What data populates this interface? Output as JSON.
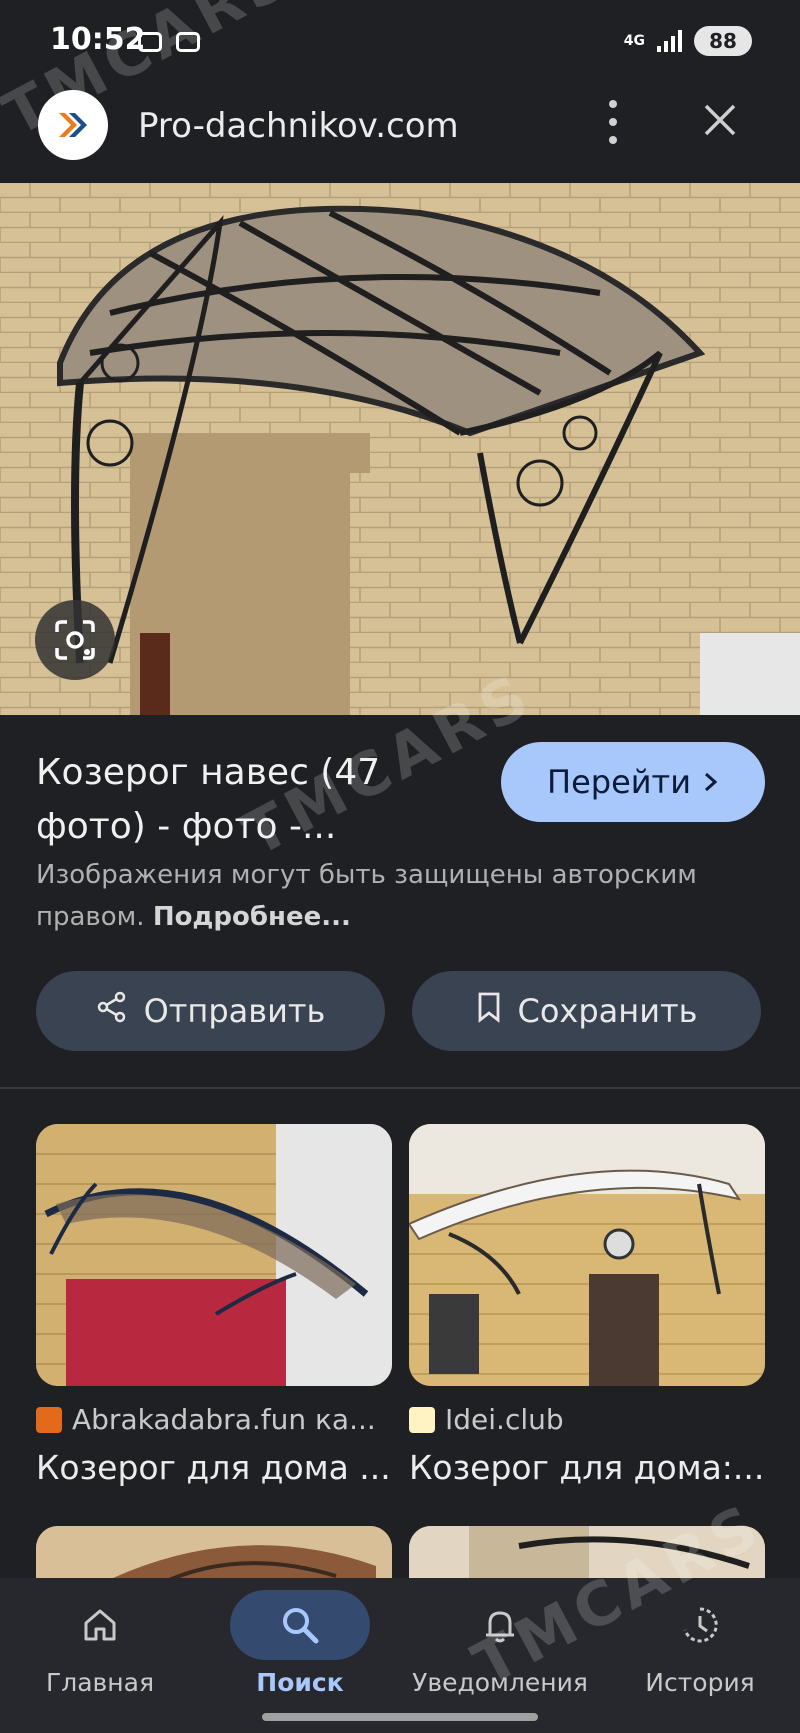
{
  "status": {
    "time": "10:52",
    "network": "4G",
    "battery": "88"
  },
  "header": {
    "site": "Pro-dachnikov.com"
  },
  "result": {
    "title": "Козерог навес (47 фото) - фото -...",
    "go_label": "Перейти",
    "copyright_text": "Изображения могут быть защищены авторским правом.",
    "more_link": "Подробнее..."
  },
  "actions": {
    "share_label": "Отправить",
    "save_label": "Сохранить"
  },
  "related": [
    {
      "source": "Abrakadabra.fun ка...",
      "caption": "Козерог для дома ..."
    },
    {
      "source": "Idei.club",
      "caption": "Козерог для дома:..."
    }
  ],
  "nav": [
    {
      "label": "Главная",
      "icon": "home-icon"
    },
    {
      "label": "Поиск",
      "icon": "search-icon",
      "active": true
    },
    {
      "label": "Уведомления",
      "icon": "bell-icon"
    },
    {
      "label": "История",
      "icon": "history-icon"
    }
  ],
  "watermark": "TMCARS",
  "colors": {
    "background": "#1f2023",
    "accent": "#a8c7fa",
    "button": "#3a4352"
  }
}
